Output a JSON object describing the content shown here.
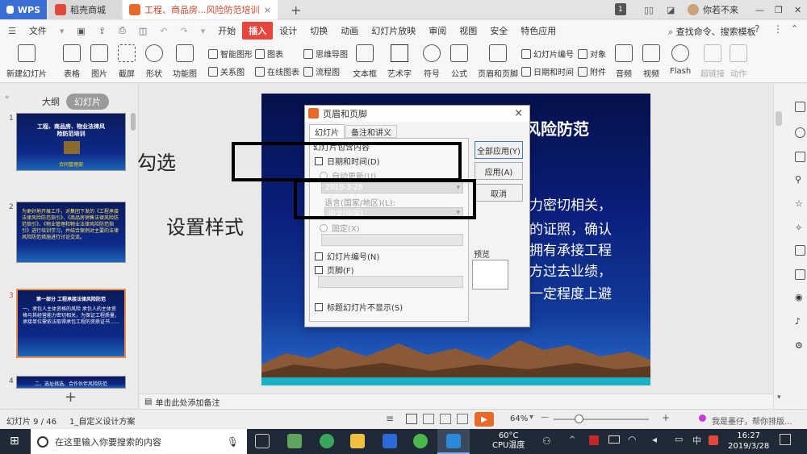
{
  "tabs": {
    "wps": "WPS",
    "store": "稻壳商城",
    "doc": "工程、商品房...风险防范培训",
    "add": "+",
    "page_badge": "1",
    "user": "你若不来"
  },
  "menu": {
    "file": "文件",
    "items": [
      "开始",
      "插入",
      "设计",
      "切换",
      "动画",
      "幻灯片放映",
      "审阅",
      "视图",
      "安全",
      "特色应用"
    ],
    "search": "查找命令、搜索模板"
  },
  "ribbon": {
    "new_slide": "新建幻灯片",
    "table": "表格",
    "picture": "图片",
    "screenshot": "截屏",
    "shape": "形状",
    "function": "功能图",
    "smart": "智能图形",
    "chart": "图表",
    "mindmap": "思维导图",
    "relation": "关系图",
    "online_chart": "在线图表",
    "flowchart": "流程图",
    "textbox": "文本框",
    "art": "艺术字",
    "symbol": "符号",
    "formula": "公式",
    "header_footer": "页眉和页脚",
    "slide_number": "幻灯片编号",
    "datetime": "日期和时间",
    "object": "对象",
    "attachment": "附件",
    "audio": "音频",
    "video": "视频",
    "flash": "Flash",
    "hyperlink": "超链接",
    "action": "动作"
  },
  "leftpane": {
    "outline": "大纲",
    "slides": "幻灯片",
    "thumbs": [
      {
        "num": "1",
        "title": "工程、商品房、物业法律风险防范培训",
        "sub": "合同管理部"
      },
      {
        "num": "2",
        "title": "为更好地开展工作，对集团下发的《工程承接法律风险防范指引》、《商品房销售法律风险防范指引》、《物业管理和物业法律风险防范指引》进行培训学习，并结合案例对主要的法律风险防范措施进行讨论交流。",
        "sub": ""
      },
      {
        "num": "3",
        "title": "第一部分 工程承接法律风险防范",
        "sub": "一、承包人主体资格的风险 承包人的主体资格与其经营能力密切相关，为保证工程质量，承接单位需依法取得承包工程的资质证书……"
      },
      {
        "num": "4",
        "title": "二、选址挑选、合作伙伴风险防范",
        "sub": ""
      }
    ],
    "add": "+"
  },
  "slide": {
    "title_tail": "风险防范",
    "lines": [
      "力密切相关，",
      "的证照，确认",
      "拥有承接工程",
      "方过去业绩，",
      "一定程度上避"
    ]
  },
  "dialog": {
    "title": "页眉和页脚",
    "tab1": "幻灯片",
    "tab2": "备注和讲义",
    "group": "幻灯片包含内容",
    "datetime": "日期和时间(D)",
    "auto": "自动更新(U)",
    "date_value": "2019-3-28",
    "lang_label": "语言(国家/地区)(L):",
    "lang_value": "中文(中国)",
    "fixed": "固定(X)",
    "slide_num": "幻灯片编号(N)",
    "footer": "页脚(F)",
    "no_title": "标题幻灯片不显示(S)",
    "preview": "预览",
    "apply_all": "全部应用(Y)",
    "apply": "应用(A)",
    "cancel": "取消"
  },
  "annotations": {
    "check": "勾选",
    "style": "设置样式"
  },
  "notes": "单击此处添加备注",
  "status": {
    "slide": "幻灯片 9 / 46",
    "template": "1_自定义设计方案",
    "zoom": "64%"
  },
  "taskbar": {
    "search": "在这里输入你要搜索的内容",
    "temp": "60°C",
    "temp_label": "CPU温度",
    "ime": "中",
    "time": "16:27",
    "date": "2019/3/28",
    "watermark_text": "我是墨仔，帮你排版..."
  }
}
